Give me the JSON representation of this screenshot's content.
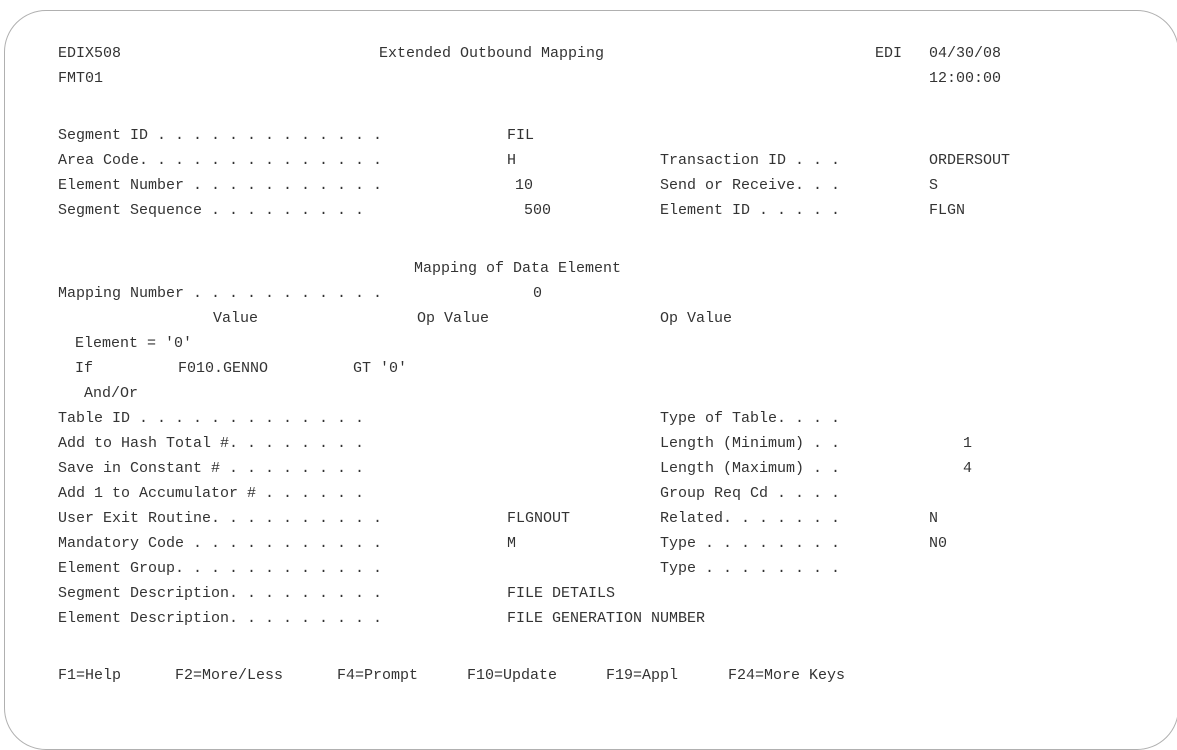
{
  "header": {
    "program": "EDIX508",
    "title": "Extended Outbound Mapping",
    "system": "EDI",
    "date": "04/30/08",
    "format": "FMT01",
    "time": "12:00:00"
  },
  "key_fields": {
    "segment_id": {
      "label": "Segment ID . . . . . . . . . . . . .",
      "value": "FIL"
    },
    "area_code": {
      "label": "Area Code. . . . . . . . . . . . . .",
      "value": "H"
    },
    "element_number": {
      "label": "Element Number . . . . . . . . . . .",
      "value": "10"
    },
    "segment_sequence": {
      "label": "Segment Sequence . . . . . . . . .",
      "value": "500"
    },
    "transaction_id": {
      "label": "Transaction ID . . .",
      "value": "ORDERSOUT"
    },
    "send_or_receive": {
      "label": "Send or Receive. . .",
      "value": "S"
    },
    "element_id": {
      "label": "Element ID . . . . .",
      "value": "FLGN"
    }
  },
  "mapping": {
    "section_title": "Mapping of Data Element",
    "mapping_number": {
      "label": "Mapping Number . . . . . . . . . . .",
      "value": "0"
    },
    "col_value": "Value",
    "col_op_value_1": "Op Value",
    "col_op_value_2": "Op Value",
    "element_line": "Element = '0'",
    "if_label": "If",
    "if_value": "F010.GENNO",
    "if_op_value": "GT '0'",
    "and_or": "And/Or"
  },
  "detail_fields": {
    "table_id": {
      "label": "Table ID . . . . . . . . . . . . .",
      "value": ""
    },
    "add_hash_total": {
      "label": "Add to Hash Total #. . . . . . . .",
      "value": ""
    },
    "save_constant": {
      "label": "Save in Constant # . . . . . . . .",
      "value": ""
    },
    "add_accumulator": {
      "label": "Add 1 to Accumulator # . . . . . .",
      "value": ""
    },
    "user_exit": {
      "label": "User Exit Routine. . . . . . . . . .",
      "value": "FLGNOUT"
    },
    "mandatory_code": {
      "label": "Mandatory Code . . . . . . . . . . .",
      "value": "M"
    },
    "element_group": {
      "label": "Element Group. . . . . . . . . . . .",
      "value": ""
    },
    "segment_description": {
      "label": "Segment Description. . . . . . . . .",
      "value": "FILE DETAILS"
    },
    "element_description": {
      "label": "Element Description. . . . . . . . .",
      "value": "FILE GENERATION NUMBER"
    },
    "type_of_table": {
      "label": "Type of Table. . . .",
      "value": ""
    },
    "length_min": {
      "label": "Length (Minimum) . .",
      "value": "1"
    },
    "length_max": {
      "label": "Length (Maximum) . .",
      "value": "4"
    },
    "group_req_cd": {
      "label": "Group Req Cd . . . .",
      "value": ""
    },
    "related": {
      "label": "Related. . . . . . .",
      "value": "N"
    },
    "type_1": {
      "label": "Type . . . . . . . .",
      "value": "N0"
    },
    "type_2": {
      "label": "Type . . . . . . . .",
      "value": ""
    }
  },
  "function_keys": {
    "f1": "F1=Help",
    "f2": "F2=More/Less",
    "f4": "F4=Prompt",
    "f10": "F10=Update",
    "f19": "F19=Appl",
    "f24": "F24=More Keys"
  }
}
